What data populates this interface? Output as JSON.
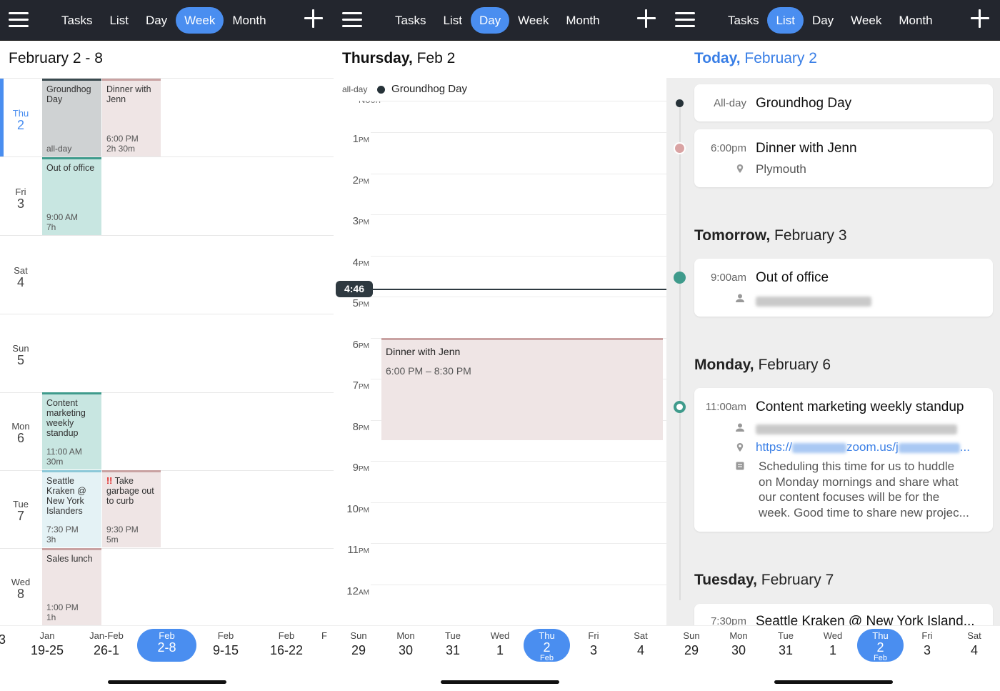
{
  "colors": {
    "accent": "#4a8ef0",
    "topbar": "#23262e",
    "today": "#3a7fe6",
    "grey_event": "#cfd2d3",
    "pink_event": "#efe5e5",
    "teal_event": "#c8e6e1"
  },
  "nav": {
    "tasks": "Tasks",
    "list": "List",
    "day": "Day",
    "week": "Week",
    "month": "Month"
  },
  "week": {
    "header": "February 2 - 8",
    "days": [
      {
        "dow": "Thu",
        "num": "2"
      },
      {
        "dow": "Fri",
        "num": "3"
      },
      {
        "dow": "Sat",
        "num": "4"
      },
      {
        "dow": "Sun",
        "num": "5"
      },
      {
        "dow": "Mon",
        "num": "6"
      },
      {
        "dow": "Tue",
        "num": "7"
      },
      {
        "dow": "Wed",
        "num": "8"
      }
    ],
    "events": {
      "groundhog": {
        "title": "Groundhog Day",
        "time": "all-day"
      },
      "dinner": {
        "title": "Dinner with Jenn",
        "time": "6:00 PM",
        "dur": "2h 30m"
      },
      "ooo": {
        "title": "Out of office",
        "time": "9:00 AM",
        "dur": "7h"
      },
      "standup": {
        "title": "Content marketing weekly standup",
        "time": "11:00 AM",
        "dur": "30m"
      },
      "kraken": {
        "title": "Seattle Kraken @ New York Islanders",
        "time": "7:30 PM",
        "dur": "3h"
      },
      "garbage": {
        "bang": "!!",
        "title": "Take garbage out to curb",
        "time": "9:30 PM",
        "dur": "5m"
      },
      "lunch": {
        "title": "Sales lunch",
        "time": "1:00 PM",
        "dur": "1h"
      }
    },
    "strip": [
      {
        "a": "",
        "b": "3"
      },
      {
        "a": "Jan",
        "b": "19-25"
      },
      {
        "a": "Jan-Feb",
        "b": "26-1"
      },
      {
        "a": "Feb",
        "b": "2-8"
      },
      {
        "a": "Feb",
        "b": "9-15"
      },
      {
        "a": "Feb",
        "b": "16-22"
      },
      {
        "a": "F",
        "b": ""
      }
    ]
  },
  "day": {
    "header_bold": "Thursday,",
    "header_rest": " Feb 2",
    "allday_label": "all-day",
    "allday_event": "Groundhog Day",
    "noon_label": "Noon",
    "hours": [
      {
        "h": "1",
        "s": "PM"
      },
      {
        "h": "2",
        "s": "PM"
      },
      {
        "h": "3",
        "s": "PM"
      },
      {
        "h": "4",
        "s": "PM"
      },
      {
        "h": "5",
        "s": "PM"
      },
      {
        "h": "6",
        "s": "PM"
      },
      {
        "h": "7",
        "s": "PM"
      },
      {
        "h": "8",
        "s": "PM"
      },
      {
        "h": "9",
        "s": "PM"
      },
      {
        "h": "10",
        "s": "PM"
      },
      {
        "h": "11",
        "s": "PM"
      },
      {
        "h": "12",
        "s": "AM"
      }
    ],
    "now": "4:46",
    "event": {
      "title": "Dinner with Jenn",
      "time": "6:00 PM – 8:30 PM"
    },
    "strip": [
      {
        "a": "Sun",
        "b": "29"
      },
      {
        "a": "Mon",
        "b": "30"
      },
      {
        "a": "Tue",
        "b": "31"
      },
      {
        "a": "Wed",
        "b": "1"
      },
      {
        "a": "Thu",
        "b": "2",
        "c": "Feb"
      },
      {
        "a": "Fri",
        "b": "3"
      },
      {
        "a": "Sat",
        "b": "4"
      }
    ]
  },
  "list": {
    "today": {
      "bold": "Today,",
      "rest": " February 2"
    },
    "tomorrow": {
      "bold": "Tomorrow,",
      "rest": " February 3"
    },
    "monday": {
      "bold": "Monday,",
      "rest": " February 6"
    },
    "tuesday": {
      "bold": "Tuesday,",
      "rest": " February 7"
    },
    "groundhog": {
      "time": "All-day",
      "title": "Groundhog Day"
    },
    "dinner": {
      "time": "6:00pm",
      "title": "Dinner with Jenn",
      "location": "Plymouth"
    },
    "ooo": {
      "time": "9:00am",
      "title": "Out of office"
    },
    "standup": {
      "time": "11:00am",
      "title": "Content marketing weekly standup",
      "link_a": "https://",
      "link_b": "zoom.us/j",
      "link_c": "...",
      "notes": [
        "Scheduling this time for us to huddle",
        "on Monday mornings and share what",
        "our content focuses will be for the",
        "week. Good time to share new projec..."
      ]
    },
    "kraken": {
      "time": "7:30pm",
      "title": "Seattle Kraken @ New York Island..."
    }
  }
}
